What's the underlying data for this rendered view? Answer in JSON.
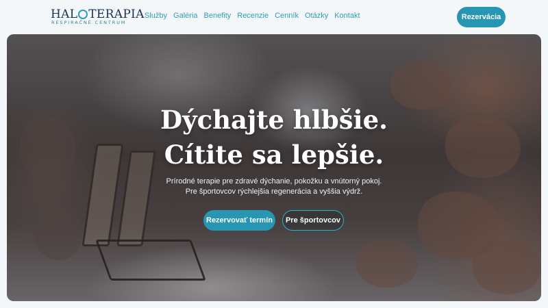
{
  "brand": {
    "name_left": "HAL",
    "name_right": "TERAPIA",
    "tagline": "RESPIRAČNÉ CENTRUM",
    "ring_icon": "circle-ring-icon",
    "accent": "#2796b2"
  },
  "nav": {
    "items": [
      {
        "label": "Služby"
      },
      {
        "label": "Galéria"
      },
      {
        "label": "Benefity"
      },
      {
        "label": "Recenzie"
      },
      {
        "label": "Cenník"
      },
      {
        "label": "Otázky"
      },
      {
        "label": "Kontakt"
      }
    ],
    "reserve_label": "Rezervácia"
  },
  "hero": {
    "headline_line1": "Dýchajte hlbšie.",
    "headline_line2": "Cítite sa lepšie.",
    "subtext_line1": "Prírodné terapie pre zdravé dýchanie, pokožku a vnútorný pokoj.",
    "subtext_line2": "Pre športovcov rýchlejšia regenerácia a vyššia výdrž.",
    "primary_cta": "Rezervovať termín",
    "secondary_cta": "Pre športovcov"
  }
}
